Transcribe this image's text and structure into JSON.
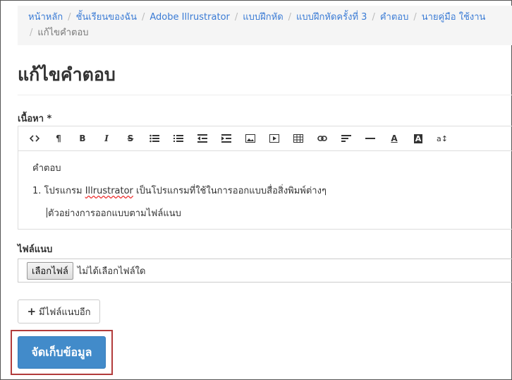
{
  "breadcrumb": {
    "items": [
      "หน้าหลัก",
      "ชั้นเรียนของฉัน",
      "Adobe Illrustrator",
      "แบบฝึกหัด",
      "แบบฝึกหัดครั้งที่ 3",
      "คำตอบ",
      "นายคู่มือ ใช้งาน"
    ],
    "current": "แก้ไขคำตอบ"
  },
  "page": {
    "title": "แก้ไขคำตอบ"
  },
  "form": {
    "content_label": "เนื้อหา *",
    "toolbar": [
      "code-view-icon",
      "paragraph-icon",
      "bold-icon",
      "italic-icon",
      "strikethrough-icon",
      "unordered-list-icon",
      "ordered-list-icon",
      "outdent-icon",
      "indent-icon",
      "image-icon",
      "video-icon",
      "table-icon",
      "link-icon",
      "align-icon",
      "horizontal-rule-icon",
      "text-color-icon",
      "background-color-icon",
      "font-size-icon"
    ],
    "editor": {
      "line1": "คำตอบ",
      "line2_prefix": "1. โปรแกรม ",
      "line2_spell": "Illrustrator",
      "line2_suffix": " เป็นโปรแกรมที่ใช้ในการออกแบบสื่อสิ่งพิมพ์ต่างๆ",
      "line3": "ตัวอย่างการออกแบบตามไฟล์แนบ"
    },
    "attachment_label": "ไฟล์แนบ",
    "file_button": "เลือกไฟล์",
    "file_status": "ไม่ได้เลือกไฟล์ใด",
    "add_attachment": "มีไฟล์แนบอีก",
    "save": "จัดเก็บข้อมูล"
  },
  "colors": {
    "link": "#3a7bd5",
    "primary": "#428bca",
    "highlight_border": "#b23b3b"
  }
}
